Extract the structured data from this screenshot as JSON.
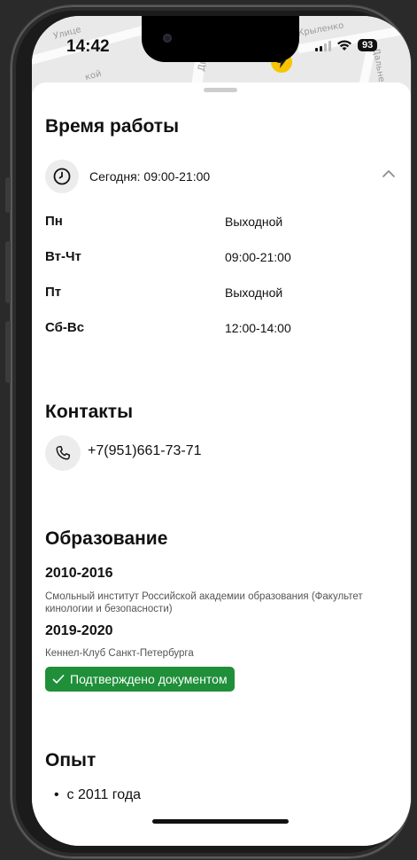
{
  "status_bar": {
    "time": "14:42",
    "battery": "93"
  },
  "map": {
    "labels": [
      "Улице",
      "Крыленко",
      "Дальне",
      "кой",
      "Дв"
    ]
  },
  "working_hours": {
    "title": "Время работы",
    "today": "Сегодня: 09:00-21:00",
    "schedule": [
      {
        "days": "Пн",
        "hours": "Выходной"
      },
      {
        "days": "Вт-Чт",
        "hours": "09:00-21:00"
      },
      {
        "days": "Пт",
        "hours": "Выходной"
      },
      {
        "days": "Сб-Вс",
        "hours": "12:00-14:00"
      }
    ]
  },
  "contacts": {
    "title": "Контакты",
    "phone": "+7(951)661-73-71"
  },
  "education": {
    "title": "Образование",
    "entries": [
      {
        "years": "2010-2016",
        "text": "Смольный институт Российской академии образования (Факультет кинологии и безопасности)"
      },
      {
        "years": "2019-2020",
        "text": "Кеннел-Клуб Санкт-Петербурга"
      }
    ],
    "verified_label": "Подтверждено документом"
  },
  "experience": {
    "title": "Опыт",
    "items": [
      "с 2011 года"
    ]
  },
  "colors": {
    "accent_green": "#1f8f3a",
    "pin_yellow": "#f6c400"
  },
  "icons": [
    "clock-icon",
    "chevron-up-icon",
    "phone-icon",
    "check-icon",
    "bolt-icon"
  ]
}
